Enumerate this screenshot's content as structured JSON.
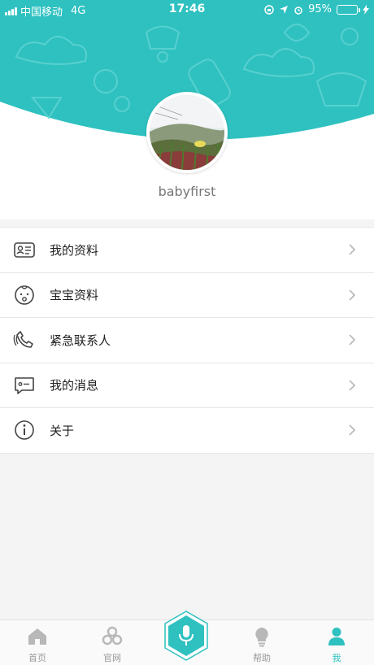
{
  "status_bar": {
    "carrier": "中国移动",
    "network": "4G",
    "time": "17:46",
    "battery_percent": "95%",
    "battery_level": 0.95
  },
  "profile": {
    "username": "babyfirst"
  },
  "menu": {
    "items": [
      {
        "label": "我的资料",
        "icon": "id-card-icon"
      },
      {
        "label": "宝宝资料",
        "icon": "baby-face-icon"
      },
      {
        "label": "紧急联系人",
        "icon": "phone-icon"
      },
      {
        "label": "我的消息",
        "icon": "message-icon"
      },
      {
        "label": "关于",
        "icon": "info-icon"
      }
    ]
  },
  "tabbar": {
    "tabs": [
      {
        "label": "首页",
        "icon": "home-icon"
      },
      {
        "label": "官网",
        "icon": "flower-icon"
      },
      {
        "label": "",
        "icon": "microphone-icon"
      },
      {
        "label": "帮助",
        "icon": "lightbulb-icon"
      },
      {
        "label": "我",
        "icon": "person-icon",
        "active": true
      }
    ]
  },
  "colors": {
    "accent": "#2ec1c0",
    "battery": "#66d34a"
  }
}
